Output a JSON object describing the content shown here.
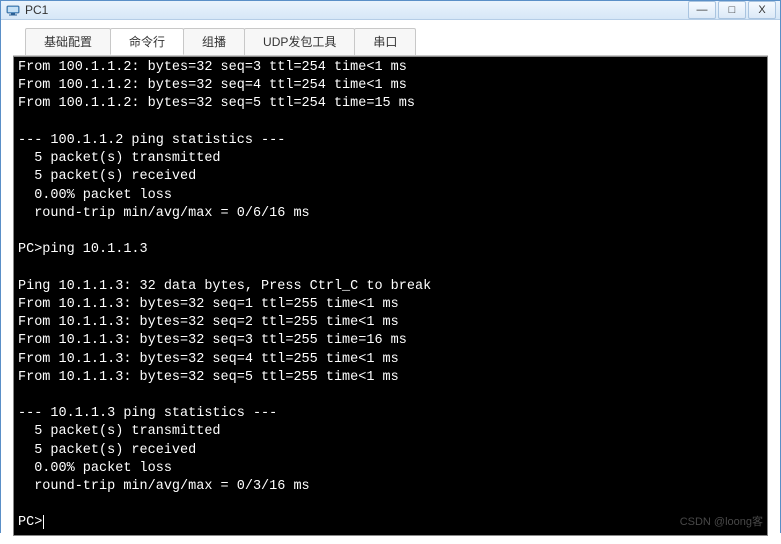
{
  "window": {
    "title": "PC1",
    "controls": {
      "minimize": "—",
      "maximize": "□",
      "close": "X"
    }
  },
  "tabs": [
    {
      "label": "基础配置",
      "active": false
    },
    {
      "label": "命令行",
      "active": true
    },
    {
      "label": "组播",
      "active": false
    },
    {
      "label": "UDP发包工具",
      "active": false
    },
    {
      "label": "串口",
      "active": false
    }
  ],
  "terminal": {
    "lines": [
      "From 100.1.1.2: bytes=32 seq=3 ttl=254 time<1 ms",
      "From 100.1.1.2: bytes=32 seq=4 ttl=254 time<1 ms",
      "From 100.1.1.2: bytes=32 seq=5 ttl=254 time=15 ms",
      "",
      "--- 100.1.1.2 ping statistics ---",
      "  5 packet(s) transmitted",
      "  5 packet(s) received",
      "  0.00% packet loss",
      "  round-trip min/avg/max = 0/6/16 ms",
      "",
      "PC>ping 10.1.1.3",
      "",
      "Ping 10.1.1.3: 32 data bytes, Press Ctrl_C to break",
      "From 10.1.1.3: bytes=32 seq=1 ttl=255 time<1 ms",
      "From 10.1.1.3: bytes=32 seq=2 ttl=255 time<1 ms",
      "From 10.1.1.3: bytes=32 seq=3 ttl=255 time=16 ms",
      "From 10.1.1.3: bytes=32 seq=4 ttl=255 time<1 ms",
      "From 10.1.1.3: bytes=32 seq=5 ttl=255 time<1 ms",
      "",
      "--- 10.1.1.3 ping statistics ---",
      "  5 packet(s) transmitted",
      "  5 packet(s) received",
      "  0.00% packet loss",
      "  round-trip min/avg/max = 0/3/16 ms",
      ""
    ],
    "prompt": "PC>"
  },
  "watermark": "CSDN @loong客"
}
